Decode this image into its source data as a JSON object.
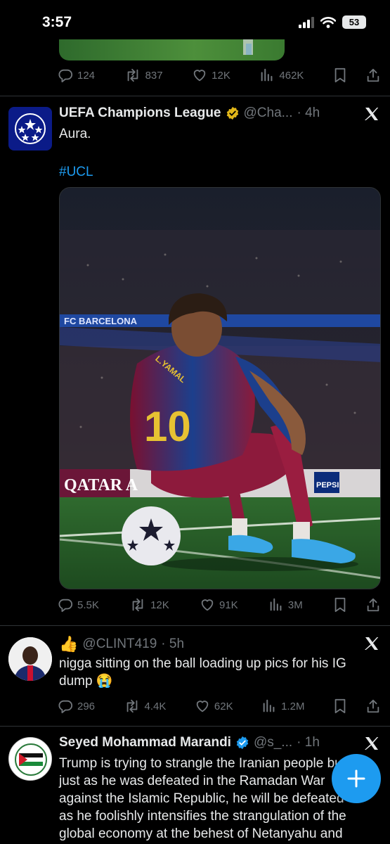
{
  "status_bar": {
    "time": "3:57",
    "battery": "53"
  },
  "tweets": [
    {
      "stats": {
        "replies": "124",
        "reposts": "837",
        "likes": "12K",
        "views": "462K"
      }
    },
    {
      "name": "UEFA Champions League",
      "handle": "@Cha...",
      "time": "· 4h",
      "text": "Aura.",
      "hashtag": "#UCL",
      "media": {
        "banner_text": "FC BARCELONA",
        "board_left": "QATAR A",
        "board_right": "PEPSI",
        "jersey_number": "10",
        "jersey_name": "L.YAMAL"
      },
      "stats": {
        "replies": "5.5K",
        "reposts": "12K",
        "likes": "91K",
        "views": "3M"
      }
    },
    {
      "emoji": "👍",
      "handle": "@CLINT419",
      "time": "· 5h",
      "text": "nigga sitting on the ball loading up pics for his IG dump 😭",
      "stats": {
        "replies": "296",
        "reposts": "4.4K",
        "likes": "62K",
        "views": "1.2M"
      }
    },
    {
      "name": "Seyed Mohammad Marandi",
      "handle": "@s_...",
      "time": "· 1h",
      "lines": [
        "Trump is trying to strangle the Iranian people but",
        "just as he was defeated in the Ramadan War",
        "against the Islamic Republic, he will be defeated",
        "as he foolishly intensifies the strangulation of the",
        "global economy at the behest of Netanyahu and"
      ]
    }
  ],
  "colors": {
    "accent": "#1d9bf0",
    "muted": "#71767b",
    "verified": "#e2b719",
    "divider": "#2f3336"
  }
}
